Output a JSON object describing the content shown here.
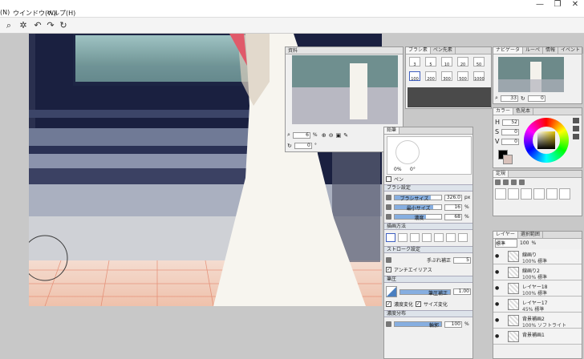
{
  "menu": {
    "items": [
      "(N)",
      "ウインドウ(W)",
      "ヘルプ(H)"
    ]
  },
  "window_controls": [
    "—",
    "❐",
    "✕"
  ],
  "toolbar": {
    "icons": [
      "zoom-icon",
      "settings-icon",
      "undo-icon",
      "redo-icon",
      "redo-all-icon"
    ]
  },
  "navigator": {
    "title": "資料",
    "zoom": "6",
    "zoom_unit": "%",
    "angle": "0",
    "angle_unit": "°"
  },
  "brush_panel": {
    "tabs": [
      "ブラシ素",
      "ペン先素"
    ],
    "sizes": [
      "3",
      "5",
      "10",
      "20",
      "50",
      "100",
      "200",
      "300",
      "500",
      "1000"
    ]
  },
  "nav_panel": {
    "tabs": [
      "ナビゲータ",
      "ルーペ",
      "情報",
      "イベント"
    ],
    "zoom": "33",
    "angle": "0"
  },
  "color_panel": {
    "tabs": [
      "カラー",
      "色見本"
    ],
    "h_label": "H",
    "h_value": "52",
    "s_label": "S",
    "s_value": "0",
    "v_label": "V",
    "v_value": "0"
  },
  "ruler_panel": {
    "tabs": [
      "定規"
    ]
  },
  "tool_settings": {
    "tabs": [
      "鉛筆"
    ],
    "preview_min": "0%",
    "preview_max": "0°",
    "tool_name": "ペン",
    "sections": {
      "brush": "ブラシ設定",
      "drawing": "描画方法",
      "stroke": "ストローク設定",
      "texture": "筆圧",
      "density": "濃度分布"
    },
    "brush_size_label": "ブラシサイズ",
    "brush_size_value": "326.0",
    "brush_size_unit": "px",
    "min_size_label": "最小サイズ",
    "min_size_value": "16",
    "min_size_unit": "%",
    "density_label": "濃度",
    "density_value": "68",
    "density_unit": "%",
    "stabilizer_label": "手ぶれ補正",
    "stabilizer_value": "5",
    "antialias_label": "アンチエイリアス",
    "pressure_label": "筆圧補正",
    "pressure_value": "1.00",
    "density_change_label": "濃度変化",
    "size_change_label": "サイズ変化",
    "distribution_label": "輪郭",
    "distribution_value": "100",
    "distribution_unit": "%"
  },
  "layers": {
    "tabs": [
      "レイヤー",
      "選択範囲"
    ],
    "mode": "標準",
    "opacity": "100",
    "opacity_unit": "%",
    "items": [
      {
        "name": "線画り",
        "mode": "100% 標準"
      },
      {
        "name": "線画り2",
        "mode": "100% 標準"
      },
      {
        "name": "レイヤー18",
        "mode": "100% 標準"
      },
      {
        "name": "レイヤー17",
        "mode": "45% 標準"
      },
      {
        "name": "背景補画2",
        "mode": "100% ソフトライト"
      },
      {
        "name": "背景補画1",
        "mode": ""
      }
    ]
  },
  "colors": {
    "accent": "#86aee0",
    "panel_bg": "#f0f0f0",
    "canvas_bg": "#1c2240"
  }
}
